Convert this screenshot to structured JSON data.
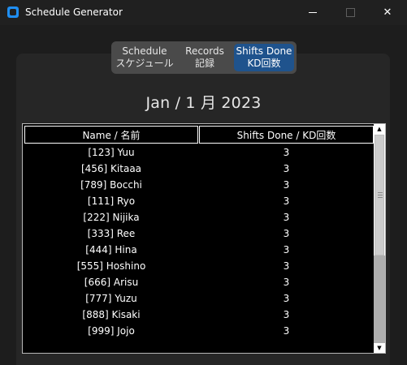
{
  "window": {
    "title": "Schedule Generator",
    "controls": {
      "minimize": "—",
      "maximize": "☐",
      "close": "✕"
    },
    "accent": "#1f8ef1"
  },
  "tabs": [
    {
      "line1": "Schedule",
      "line2": "スケジュール",
      "selected": false
    },
    {
      "line1": "Records",
      "line2": "記録",
      "selected": false
    },
    {
      "line1": "Shifts Done",
      "line2": "KD回数",
      "selected": true
    }
  ],
  "date_label": "Jan / 1 月 2023",
  "table": {
    "columns": [
      "Name / 名前",
      "Shifts Done / KD回数"
    ],
    "rows": [
      {
        "name": "[123] Yuu",
        "count": "3"
      },
      {
        "name": "[456] Kitaaa",
        "count": "3"
      },
      {
        "name": "[789] Bocchi",
        "count": "3"
      },
      {
        "name": "[111] Ryo",
        "count": "3"
      },
      {
        "name": "[222] Nijika",
        "count": "3"
      },
      {
        "name": "[333] Ree",
        "count": "3"
      },
      {
        "name": "[444] Hina",
        "count": "3"
      },
      {
        "name": "[555] Hoshino",
        "count": "3"
      },
      {
        "name": "[666] Arisu",
        "count": "3"
      },
      {
        "name": "[777] Yuzu",
        "count": "3"
      },
      {
        "name": "[888] Kisaki",
        "count": "3"
      },
      {
        "name": "[999] Jojo",
        "count": "3"
      }
    ]
  },
  "scrollbar": {
    "up_arrow": "▲",
    "down_arrow": "▼"
  }
}
